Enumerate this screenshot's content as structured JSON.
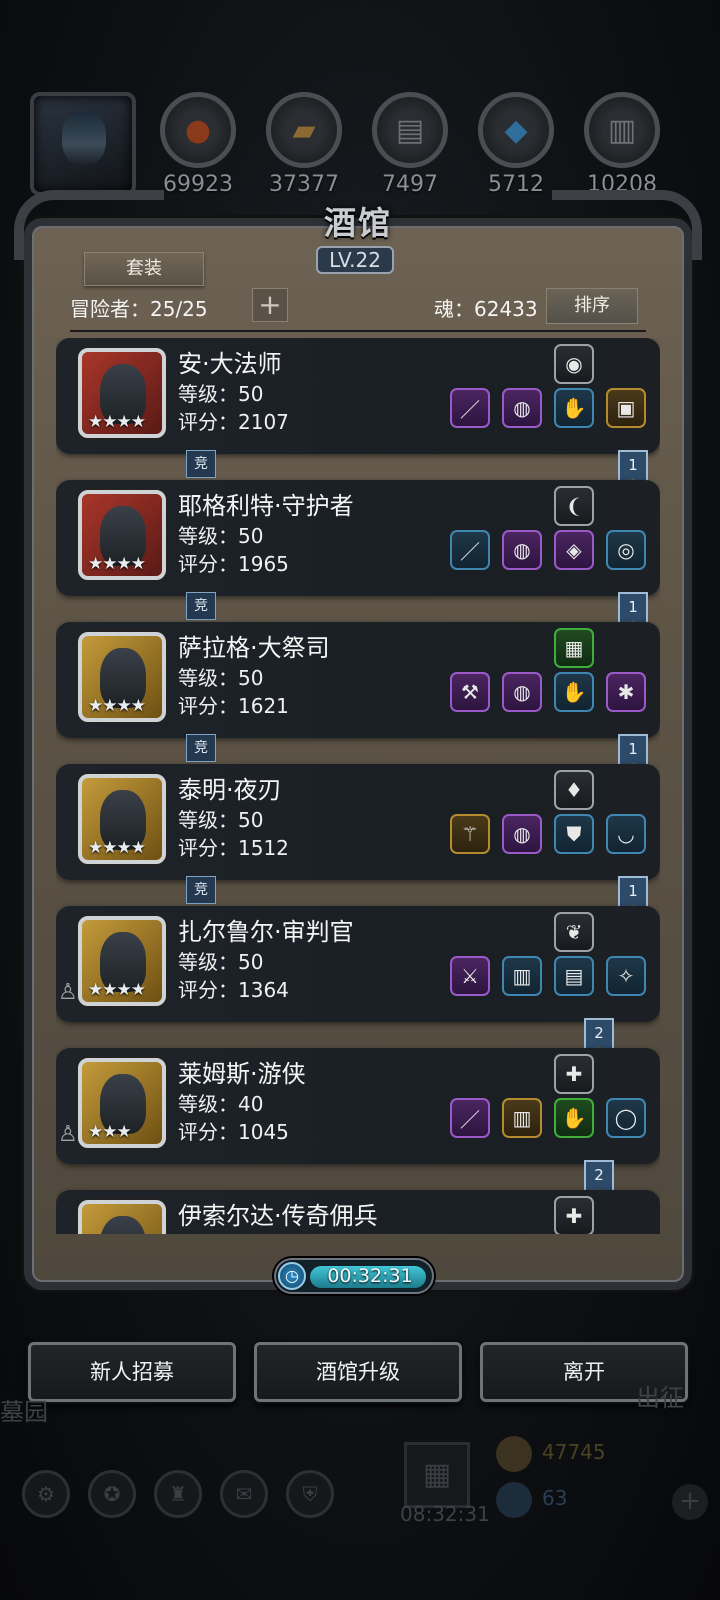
{
  "top_resources": [
    {
      "icon": "meat-icon",
      "value": "69923"
    },
    {
      "icon": "wood-icon",
      "value": "37377"
    },
    {
      "icon": "stone-icon",
      "value": "7497"
    },
    {
      "icon": "crystal-icon",
      "value": "5712"
    },
    {
      "icon": "iron-icon",
      "value": "10208"
    }
  ],
  "tavern": {
    "title": "酒馆",
    "level": "LV.22",
    "suit_button": "套装",
    "adventurers_text": "冒险者：25/25",
    "soul_text": "魂：62433",
    "sort_button": "排序",
    "timer": "00:32:31"
  },
  "heroes": [
    {
      "name": "安·大法师",
      "level": "等级：50",
      "score": "评分：2107",
      "stars": "★★★★",
      "frame": "red",
      "arena": "竞",
      "rank": "1"
    },
    {
      "name": "耶格利特·守护者",
      "level": "等级：50",
      "score": "评分：1965",
      "stars": "★★★★",
      "frame": "red",
      "arena": "竞",
      "rank": "1"
    },
    {
      "name": "萨拉格·大祭司",
      "level": "等级：50",
      "score": "评分：1621",
      "stars": "★★★★",
      "frame": "gold",
      "arena": "竞",
      "rank": "1"
    },
    {
      "name": "泰明·夜刃",
      "level": "等级：50",
      "score": "评分：1512",
      "stars": "★★★★",
      "frame": "gold",
      "arena": "竞",
      "rank": "1"
    },
    {
      "name": "扎尔鲁尔·审判官",
      "level": "等级：50",
      "score": "评分：1364",
      "stars": "★★★★",
      "frame": "gold",
      "arena": "",
      "rank": "2"
    },
    {
      "name": "莱姆斯·游侠",
      "level": "等级：40",
      "score": "评分：1045",
      "stars": "★★★",
      "frame": "gold",
      "arena": "",
      "rank": "2"
    },
    {
      "name": "伊索尔达·传奇佣兵",
      "level": "",
      "score": "",
      "stars": "",
      "frame": "gold",
      "arena": "",
      "rank": ""
    }
  ],
  "bottom_buttons": {
    "recruit": "新人招募",
    "upgrade": "酒馆升级",
    "leave": "离开"
  },
  "background_bar": {
    "left_label": "墓园",
    "right_label": "出征",
    "gold": "47745",
    "gems": "63",
    "gift_timer": "08:32:31"
  },
  "colors": {
    "panel_bg": "#5d5446",
    "card_bg": "#1d2329",
    "timer_fill": "#41c7d7",
    "rank_ribbon": "#2d4a68"
  }
}
